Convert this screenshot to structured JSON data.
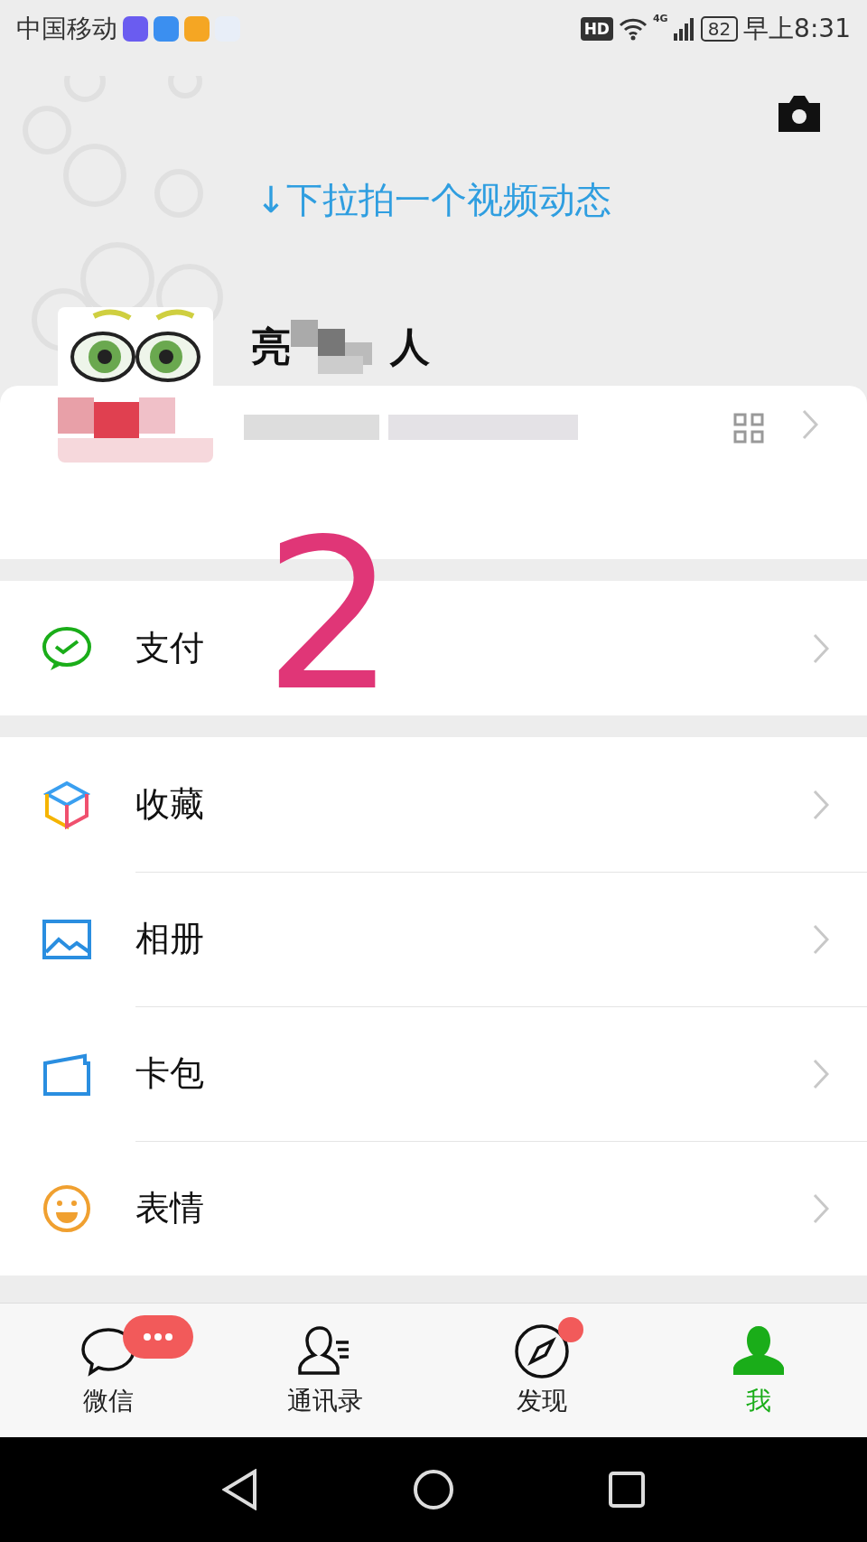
{
  "status_bar": {
    "carrier": "中国移动",
    "hd": "HD",
    "network": "4G",
    "battery": "82",
    "time": "早上8:31"
  },
  "pull_hint": "↓下拉拍一个视频动态",
  "profile": {
    "name_start": "亮",
    "name_end": "人"
  },
  "annotation": "2",
  "menu_groups": [
    [
      {
        "label": "支付",
        "kind": "pay"
      }
    ],
    [
      {
        "label": "收藏",
        "kind": "favorites"
      },
      {
        "label": "相册",
        "kind": "album"
      },
      {
        "label": "卡包",
        "kind": "cards"
      },
      {
        "label": "表情",
        "kind": "stickers"
      }
    ]
  ],
  "tabs": [
    {
      "label": "微信",
      "kind": "chat",
      "selected": false,
      "badge": {
        "kind": "more"
      }
    },
    {
      "label": "通讯录",
      "kind": "contacts",
      "selected": false
    },
    {
      "label": "发现",
      "kind": "discover",
      "selected": false,
      "badge": {
        "kind": "dot"
      }
    },
    {
      "label": "我",
      "kind": "me",
      "selected": true
    }
  ]
}
